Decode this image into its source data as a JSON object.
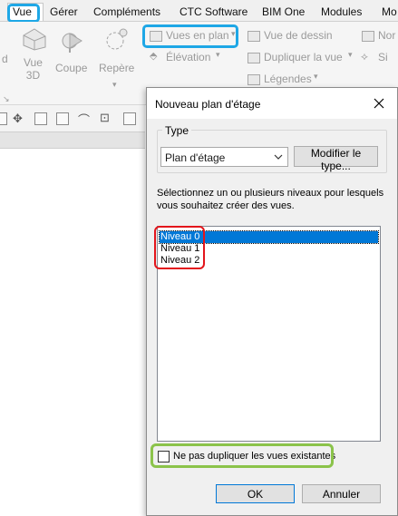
{
  "menu": {
    "vue": "Vue",
    "gerer": "Gérer",
    "complements": "Compléments",
    "ctc": "CTC Software",
    "bim": "BIM One",
    "modules": "Modules",
    "mo": "Mo"
  },
  "ribbon": {
    "d_label": "d",
    "vue3d_label": "Vue\n3D",
    "coupe_label": "Coupe",
    "repere_label": "Repère",
    "vues_en_plan": "Vues en plan",
    "elevation": "Élévation",
    "vue_de_dessin": "Vue de dessin",
    "dupliquer_vue": "Dupliquer la vue",
    "legendes": "Légendes",
    "nor": "Nor",
    "si": "Si"
  },
  "dialog": {
    "title": "Nouveau plan d'étage",
    "type_group": "Type",
    "type_value": "Plan d'étage",
    "modify_type": "Modifier le type...",
    "instruction": "Sélectionnez un ou plusieurs niveaux pour lesquels vous souhaitez créer des vues.",
    "levels": [
      "Niveau 0",
      "Niveau 1",
      "Niveau 2"
    ],
    "no_duplicate": "Ne pas dupliquer les vues existantes",
    "ok": "OK",
    "cancel": "Annuler"
  },
  "colors": {
    "highlight_blue": "#1ea7e6",
    "highlight_red": "#e3151b",
    "highlight_green": "#8bc34a",
    "selection": "#0078d7"
  }
}
